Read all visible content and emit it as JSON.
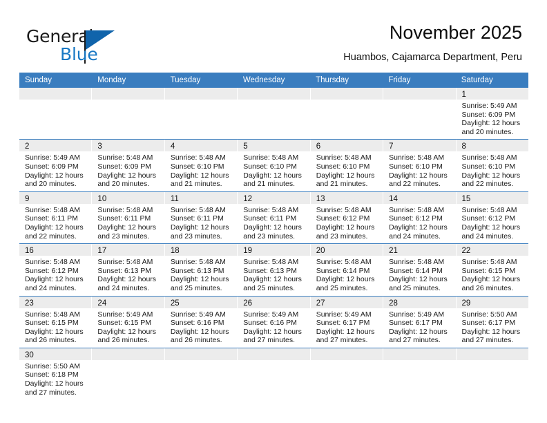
{
  "brand": {
    "name_top": "General",
    "name_bottom": "Blue",
    "accent_color": "#1878c4",
    "flag_color": "#1064ab"
  },
  "header": {
    "title": "November 2025",
    "subtitle": "Huambos, Cajamarca Department, Peru"
  },
  "theme": {
    "header_row_bg": "#3a7dbf",
    "daynum_band_bg": "#ececec",
    "row_separator": "#3a7dbf",
    "page_bg": "#ffffff",
    "text": "#1a1a1a"
  },
  "calendar": {
    "weekdays": [
      "Sunday",
      "Monday",
      "Tuesday",
      "Wednesday",
      "Thursday",
      "Friday",
      "Saturday"
    ],
    "weeks": [
      [
        {
          "day": "",
          "empty": true,
          "sunrise": "",
          "sunset": "",
          "daylight1": "",
          "daylight2": ""
        },
        {
          "day": "",
          "empty": true,
          "sunrise": "",
          "sunset": "",
          "daylight1": "",
          "daylight2": ""
        },
        {
          "day": "",
          "empty": true,
          "sunrise": "",
          "sunset": "",
          "daylight1": "",
          "daylight2": ""
        },
        {
          "day": "",
          "empty": true,
          "sunrise": "",
          "sunset": "",
          "daylight1": "",
          "daylight2": ""
        },
        {
          "day": "",
          "empty": true,
          "sunrise": "",
          "sunset": "",
          "daylight1": "",
          "daylight2": ""
        },
        {
          "day": "",
          "empty": true,
          "sunrise": "",
          "sunset": "",
          "daylight1": "",
          "daylight2": ""
        },
        {
          "day": "1",
          "empty": false,
          "sunrise": "Sunrise: 5:49 AM",
          "sunset": "Sunset: 6:09 PM",
          "daylight1": "Daylight: 12 hours",
          "daylight2": "and 20 minutes."
        }
      ],
      [
        {
          "day": "2",
          "empty": false,
          "sunrise": "Sunrise: 5:49 AM",
          "sunset": "Sunset: 6:09 PM",
          "daylight1": "Daylight: 12 hours",
          "daylight2": "and 20 minutes."
        },
        {
          "day": "3",
          "empty": false,
          "sunrise": "Sunrise: 5:48 AM",
          "sunset": "Sunset: 6:09 PM",
          "daylight1": "Daylight: 12 hours",
          "daylight2": "and 20 minutes."
        },
        {
          "day": "4",
          "empty": false,
          "sunrise": "Sunrise: 5:48 AM",
          "sunset": "Sunset: 6:10 PM",
          "daylight1": "Daylight: 12 hours",
          "daylight2": "and 21 minutes."
        },
        {
          "day": "5",
          "empty": false,
          "sunrise": "Sunrise: 5:48 AM",
          "sunset": "Sunset: 6:10 PM",
          "daylight1": "Daylight: 12 hours",
          "daylight2": "and 21 minutes."
        },
        {
          "day": "6",
          "empty": false,
          "sunrise": "Sunrise: 5:48 AM",
          "sunset": "Sunset: 6:10 PM",
          "daylight1": "Daylight: 12 hours",
          "daylight2": "and 21 minutes."
        },
        {
          "day": "7",
          "empty": false,
          "sunrise": "Sunrise: 5:48 AM",
          "sunset": "Sunset: 6:10 PM",
          "daylight1": "Daylight: 12 hours",
          "daylight2": "and 22 minutes."
        },
        {
          "day": "8",
          "empty": false,
          "sunrise": "Sunrise: 5:48 AM",
          "sunset": "Sunset: 6:10 PM",
          "daylight1": "Daylight: 12 hours",
          "daylight2": "and 22 minutes."
        }
      ],
      [
        {
          "day": "9",
          "empty": false,
          "sunrise": "Sunrise: 5:48 AM",
          "sunset": "Sunset: 6:11 PM",
          "daylight1": "Daylight: 12 hours",
          "daylight2": "and 22 minutes."
        },
        {
          "day": "10",
          "empty": false,
          "sunrise": "Sunrise: 5:48 AM",
          "sunset": "Sunset: 6:11 PM",
          "daylight1": "Daylight: 12 hours",
          "daylight2": "and 23 minutes."
        },
        {
          "day": "11",
          "empty": false,
          "sunrise": "Sunrise: 5:48 AM",
          "sunset": "Sunset: 6:11 PM",
          "daylight1": "Daylight: 12 hours",
          "daylight2": "and 23 minutes."
        },
        {
          "day": "12",
          "empty": false,
          "sunrise": "Sunrise: 5:48 AM",
          "sunset": "Sunset: 6:11 PM",
          "daylight1": "Daylight: 12 hours",
          "daylight2": "and 23 minutes."
        },
        {
          "day": "13",
          "empty": false,
          "sunrise": "Sunrise: 5:48 AM",
          "sunset": "Sunset: 6:12 PM",
          "daylight1": "Daylight: 12 hours",
          "daylight2": "and 23 minutes."
        },
        {
          "day": "14",
          "empty": false,
          "sunrise": "Sunrise: 5:48 AM",
          "sunset": "Sunset: 6:12 PM",
          "daylight1": "Daylight: 12 hours",
          "daylight2": "and 24 minutes."
        },
        {
          "day": "15",
          "empty": false,
          "sunrise": "Sunrise: 5:48 AM",
          "sunset": "Sunset: 6:12 PM",
          "daylight1": "Daylight: 12 hours",
          "daylight2": "and 24 minutes."
        }
      ],
      [
        {
          "day": "16",
          "empty": false,
          "sunrise": "Sunrise: 5:48 AM",
          "sunset": "Sunset: 6:12 PM",
          "daylight1": "Daylight: 12 hours",
          "daylight2": "and 24 minutes."
        },
        {
          "day": "17",
          "empty": false,
          "sunrise": "Sunrise: 5:48 AM",
          "sunset": "Sunset: 6:13 PM",
          "daylight1": "Daylight: 12 hours",
          "daylight2": "and 24 minutes."
        },
        {
          "day": "18",
          "empty": false,
          "sunrise": "Sunrise: 5:48 AM",
          "sunset": "Sunset: 6:13 PM",
          "daylight1": "Daylight: 12 hours",
          "daylight2": "and 25 minutes."
        },
        {
          "day": "19",
          "empty": false,
          "sunrise": "Sunrise: 5:48 AM",
          "sunset": "Sunset: 6:13 PM",
          "daylight1": "Daylight: 12 hours",
          "daylight2": "and 25 minutes."
        },
        {
          "day": "20",
          "empty": false,
          "sunrise": "Sunrise: 5:48 AM",
          "sunset": "Sunset: 6:14 PM",
          "daylight1": "Daylight: 12 hours",
          "daylight2": "and 25 minutes."
        },
        {
          "day": "21",
          "empty": false,
          "sunrise": "Sunrise: 5:48 AM",
          "sunset": "Sunset: 6:14 PM",
          "daylight1": "Daylight: 12 hours",
          "daylight2": "and 25 minutes."
        },
        {
          "day": "22",
          "empty": false,
          "sunrise": "Sunrise: 5:48 AM",
          "sunset": "Sunset: 6:15 PM",
          "daylight1": "Daylight: 12 hours",
          "daylight2": "and 26 minutes."
        }
      ],
      [
        {
          "day": "23",
          "empty": false,
          "sunrise": "Sunrise: 5:48 AM",
          "sunset": "Sunset: 6:15 PM",
          "daylight1": "Daylight: 12 hours",
          "daylight2": "and 26 minutes."
        },
        {
          "day": "24",
          "empty": false,
          "sunrise": "Sunrise: 5:49 AM",
          "sunset": "Sunset: 6:15 PM",
          "daylight1": "Daylight: 12 hours",
          "daylight2": "and 26 minutes."
        },
        {
          "day": "25",
          "empty": false,
          "sunrise": "Sunrise: 5:49 AM",
          "sunset": "Sunset: 6:16 PM",
          "daylight1": "Daylight: 12 hours",
          "daylight2": "and 26 minutes."
        },
        {
          "day": "26",
          "empty": false,
          "sunrise": "Sunrise: 5:49 AM",
          "sunset": "Sunset: 6:16 PM",
          "daylight1": "Daylight: 12 hours",
          "daylight2": "and 27 minutes."
        },
        {
          "day": "27",
          "empty": false,
          "sunrise": "Sunrise: 5:49 AM",
          "sunset": "Sunset: 6:17 PM",
          "daylight1": "Daylight: 12 hours",
          "daylight2": "and 27 minutes."
        },
        {
          "day": "28",
          "empty": false,
          "sunrise": "Sunrise: 5:49 AM",
          "sunset": "Sunset: 6:17 PM",
          "daylight1": "Daylight: 12 hours",
          "daylight2": "and 27 minutes."
        },
        {
          "day": "29",
          "empty": false,
          "sunrise": "Sunrise: 5:50 AM",
          "sunset": "Sunset: 6:17 PM",
          "daylight1": "Daylight: 12 hours",
          "daylight2": "and 27 minutes."
        }
      ],
      [
        {
          "day": "30",
          "empty": false,
          "sunrise": "Sunrise: 5:50 AM",
          "sunset": "Sunset: 6:18 PM",
          "daylight1": "Daylight: 12 hours",
          "daylight2": "and 27 minutes."
        },
        {
          "day": "",
          "empty": true,
          "sunrise": "",
          "sunset": "",
          "daylight1": "",
          "daylight2": ""
        },
        {
          "day": "",
          "empty": true,
          "sunrise": "",
          "sunset": "",
          "daylight1": "",
          "daylight2": ""
        },
        {
          "day": "",
          "empty": true,
          "sunrise": "",
          "sunset": "",
          "daylight1": "",
          "daylight2": ""
        },
        {
          "day": "",
          "empty": true,
          "sunrise": "",
          "sunset": "",
          "daylight1": "",
          "daylight2": ""
        },
        {
          "day": "",
          "empty": true,
          "sunrise": "",
          "sunset": "",
          "daylight1": "",
          "daylight2": ""
        },
        {
          "day": "",
          "empty": true,
          "sunrise": "",
          "sunset": "",
          "daylight1": "",
          "daylight2": ""
        }
      ]
    ]
  }
}
